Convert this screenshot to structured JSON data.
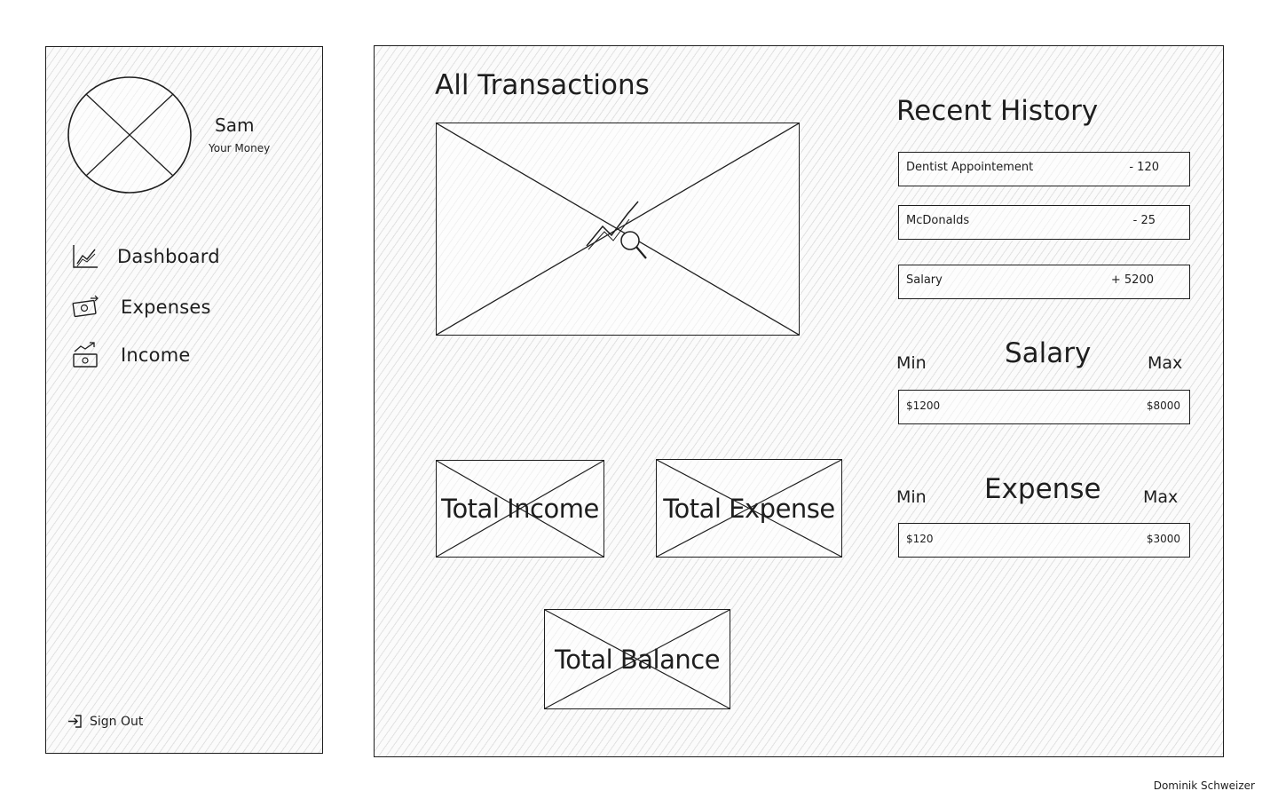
{
  "sidebar": {
    "profile": {
      "name": "Sam",
      "subtitle": "Your Money"
    },
    "nav": [
      {
        "label": "Dashboard",
        "icon": "line-chart-icon"
      },
      {
        "label": "Expenses",
        "icon": "money-bill-icon"
      },
      {
        "label": "Income",
        "icon": "income-trend-icon"
      }
    ],
    "sign_out": {
      "label": "Sign Out",
      "icon": "sign-out-icon"
    }
  },
  "main": {
    "title": "All Transactions",
    "chart_placeholder": {
      "icon": "chart-search-icon"
    },
    "cards": {
      "total_income": "Total Income",
      "total_expense": "Total Expense",
      "total_balance": "Total Balance"
    },
    "recent_history": {
      "title": "Recent History",
      "items": [
        {
          "name": "Dentist Appointement",
          "amount": "- 120"
        },
        {
          "name": "McDonalds",
          "amount": "- 25"
        },
        {
          "name": "Salary",
          "amount": "+ 5200"
        }
      ]
    },
    "salary": {
      "title": "Salary",
      "min_label": "Min",
      "max_label": "Max",
      "min": "$1200",
      "max": "$8000"
    },
    "expense": {
      "title": "Expense",
      "min_label": "Min",
      "max_label": "Max",
      "min": "$120",
      "max": "$3000"
    }
  },
  "footer": {
    "author": "Dominik Schweizer"
  }
}
